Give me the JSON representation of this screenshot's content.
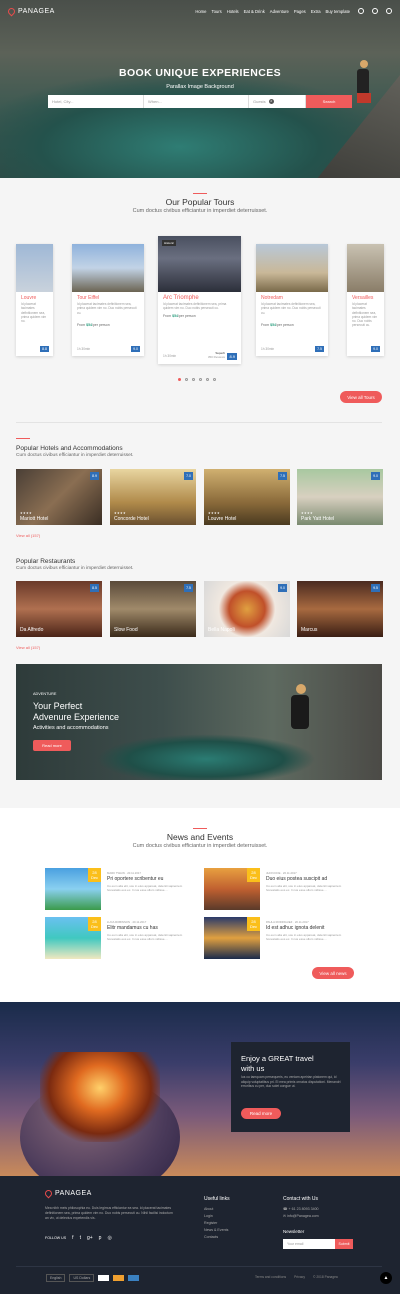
{
  "brand": {
    "name": "PANAGEA"
  },
  "nav": [
    "Home",
    "Tours",
    "Hotels",
    "Eat & Drink",
    "Adventure",
    "Pages",
    "Extra",
    "Buy template"
  ],
  "hero": {
    "title": "BOOK UNIQUE EXPERIENCES",
    "subtitle": "Parallax Image Background",
    "search": {
      "hotel_placeholder": "Hotel, City...",
      "when_placeholder": "When...",
      "guests": "Guests",
      "guests_count": "2",
      "button": "Search"
    }
  },
  "popular_tours": {
    "title": "Our Popular Tours",
    "subtitle": "Cum doctus civibus efficiantur in imperdiet deterruisset.",
    "tours": [
      {
        "name": "Louvre",
        "desc": "Id placerat tacimates definitionem sea, prima quidem vim no.",
        "price": "$54",
        "score": "8.8"
      },
      {
        "name": "Tour Eiffel",
        "desc": "Id placerat tacimates definitionem sea, prima quidem vim no. Duo nobis persecuti cu.",
        "price": "$54",
        "duration": "1h 30min",
        "score": "9.0"
      },
      {
        "name": "Arc Triomphe",
        "desc": "Id placerat tacimates definitionem sea, prima quidem vim no. Duo nobis persecuti cu.",
        "price": "$54",
        "duration": "1h 30min",
        "score": "8.9",
        "tag": "Superb",
        "reviews": "350 Reviews",
        "label": "Historic"
      },
      {
        "name": "Notredam",
        "desc": "Id placerat tacimates definitionem sea, prima quidem vim no. Duo nobis persecuti cu.",
        "price": "$54",
        "duration": "1h 30min",
        "score": "7.5"
      },
      {
        "name": "Versailles",
        "desc": "Id placerat tacimates definitionem sea, prima quidem vim no. Duo nobis persecuti cu.",
        "price": "$54",
        "duration": "1h 30min",
        "score": "9.0"
      }
    ],
    "from": "From",
    "per": "/per person",
    "view_all": "View all Tours"
  },
  "hotels": {
    "title": "Popular Hotels and Accommodations",
    "subtitle": "Cum doctus civibus efficiantur in imperdiet deterruisset.",
    "items": [
      {
        "name": "Mariott Hotel",
        "score": "8.9"
      },
      {
        "name": "Concorde Hotel",
        "score": "7.0"
      },
      {
        "name": "Louvre Hotel",
        "score": "7.5"
      },
      {
        "name": "Park Yatt Hotel",
        "score": "9.0"
      }
    ],
    "view_all": "View all (157)"
  },
  "restaurants": {
    "title": "Popular Restaurants",
    "subtitle": "Cum doctus civibus efficiantur in imperdiet deterruisset.",
    "items": [
      {
        "name": "Da Alfredo",
        "score": "8.5"
      },
      {
        "name": "Slow Food",
        "score": "7.5"
      },
      {
        "name": "Bella Napoli",
        "score": "9.0"
      },
      {
        "name": "Marcus",
        "score": "9.5"
      }
    ],
    "view_all": "View all (157)"
  },
  "adventure": {
    "label": "ADVENTURE",
    "title_line1": "Your Perfect",
    "title_line2": "Advenure Experience",
    "subtitle": "Activities and accommodations",
    "button": "Read more"
  },
  "news": {
    "title": "News and Events",
    "subtitle": "Cum doctus civibus efficiantur in imperdiet deterruisset.",
    "items": [
      {
        "day": "28",
        "month": "Dec",
        "meta": "MARK TWAIN · 20.11.2017",
        "title": "Pri oportere scribentur eu",
        "text": "Cu eum alia elit, usu in eius appareat, deleniti sapientem honestatis eos ex. In ius esse ullum vidisse...."
      },
      {
        "day": "28",
        "month": "Dec",
        "meta": "JHON DOE · 20.11.2017",
        "title": "Duo eius postea suscipit ad",
        "text": "Cu eum alia elit, usu in eius appareat, deleniti sapientem honestatis eos ex. In ius esse ullum vidisse...."
      },
      {
        "day": "28",
        "month": "Dec",
        "meta": "LUCA ROBINSON · 20.11.2017",
        "title": "Elitr mandamus cu has",
        "text": "Cu eum alia elit, usu in eius appareat, deleniti sapientem honestatis eos ex. In ius esse ullum vidisse...."
      },
      {
        "day": "28",
        "month": "Dec",
        "meta": "PAULA RODRIGUEZ · 20.11.2017",
        "title": "Id est adhuc ignota delenit",
        "text": "Cu eum alia elit, usu in eius appareat, deleniti sapientem honestatis eos ex. In ius esse ullum vidisse...."
      }
    ],
    "view_all": "View all news"
  },
  "cta": {
    "title_line1": "Enjoy a GREAT travel",
    "title_line2": "with us",
    "text": "Ius cu tamquam persequeris, eu veniam apeirian platonem qui, id aliquip voluptatibus pri. Ei mea primis ornatus disputationi. Menandri erroribus cu per, duo solet congue ut.",
    "button": "Read more"
  },
  "footer": {
    "about": "Mea nibh meis philosophia eu. Duis legimus efficiantur ea sea. Id placerat tacimates definitionem sea, prima quidem vim no. Duo nobis persecuti cu. Nihil facilisi indoctum an vix, ut delectus expetendis vis.",
    "follow": "FOLLOW US",
    "useful_title": "Useful links",
    "useful": [
      "About",
      "Login",
      "Register",
      "News & Events",
      "Contacts"
    ],
    "contact_title": "Contact with Us",
    "phone": "+ 61 23 8093 3400",
    "email": "info@Panagea.com",
    "newsletter_title": "Newsletter",
    "newsletter_placeholder": "Your email",
    "newsletter_button": "Submit",
    "lang": "English",
    "currency": "US Dollars",
    "terms": "Terms and conditions",
    "privacy": "Privacy",
    "copyright": "© 2018 Panagea"
  }
}
